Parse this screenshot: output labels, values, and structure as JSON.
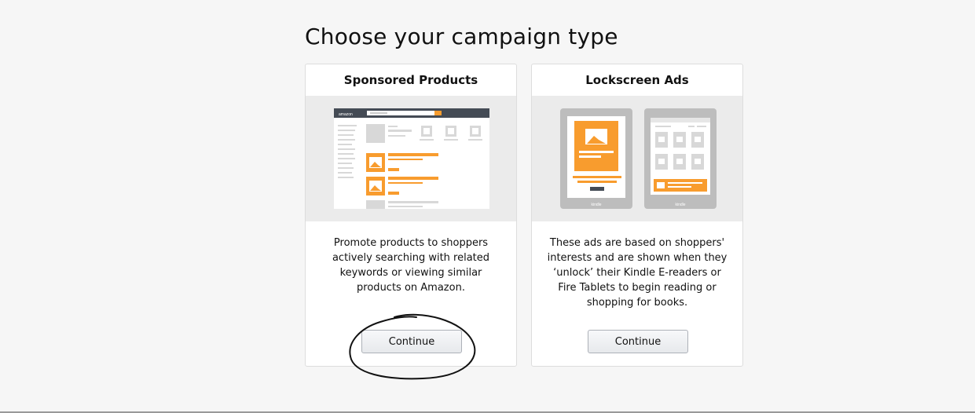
{
  "page": {
    "title": "Choose your campaign type"
  },
  "cards": [
    {
      "title": "Sponsored Products",
      "description": "Promote products to shoppers actively searching with related keywords or viewing similar products on Amazon.",
      "button_label": "Continue",
      "illustration_logo": "amazon"
    },
    {
      "title": "Lockscreen Ads",
      "description": "These ads are based on shoppers' interests and are shown when they ‘unlock’ their Kindle E-readers or Fire Tablets to begin reading or shopping for books.",
      "button_label": "Continue",
      "device_labels": [
        "kindle",
        "kindle"
      ]
    }
  ],
  "colors": {
    "accent": "#f89c2e",
    "placeholder": "#d8d8d8",
    "illus_bg": "#ebebeb"
  },
  "icons": [
    "image-placeholder-icon",
    "search-icon"
  ]
}
